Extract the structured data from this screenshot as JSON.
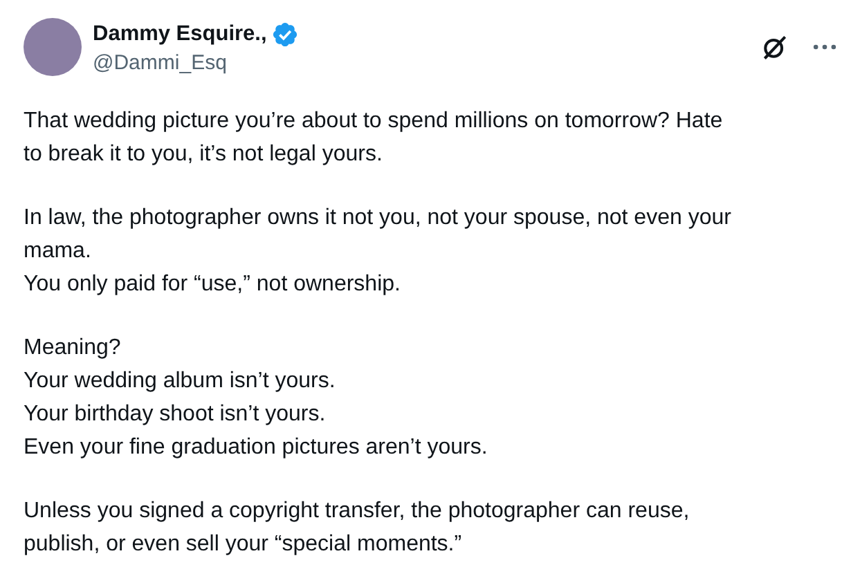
{
  "author": {
    "name": "Dammy Esquire.,",
    "handle": "@Dammi_Esq",
    "verified": true
  },
  "paragraphs": [
    [
      "That wedding picture you’re about to spend millions on tomorrow? Hate",
      "to break it to you, it’s not legal yours."
    ],
    [
      "In law, the photographer owns it not you, not your spouse, not even your",
      "mama.",
      "You only paid for “use,” not ownership."
    ],
    [
      "Meaning?",
      "Your wedding album isn’t yours.",
      "Your birthday shoot isn’t yours.",
      "Even your fine graduation pictures aren’t yours."
    ],
    [
      "Unless you signed a copyright transfer, the photographer can reuse,",
      "publish, or even sell your “special moments.”"
    ]
  ]
}
